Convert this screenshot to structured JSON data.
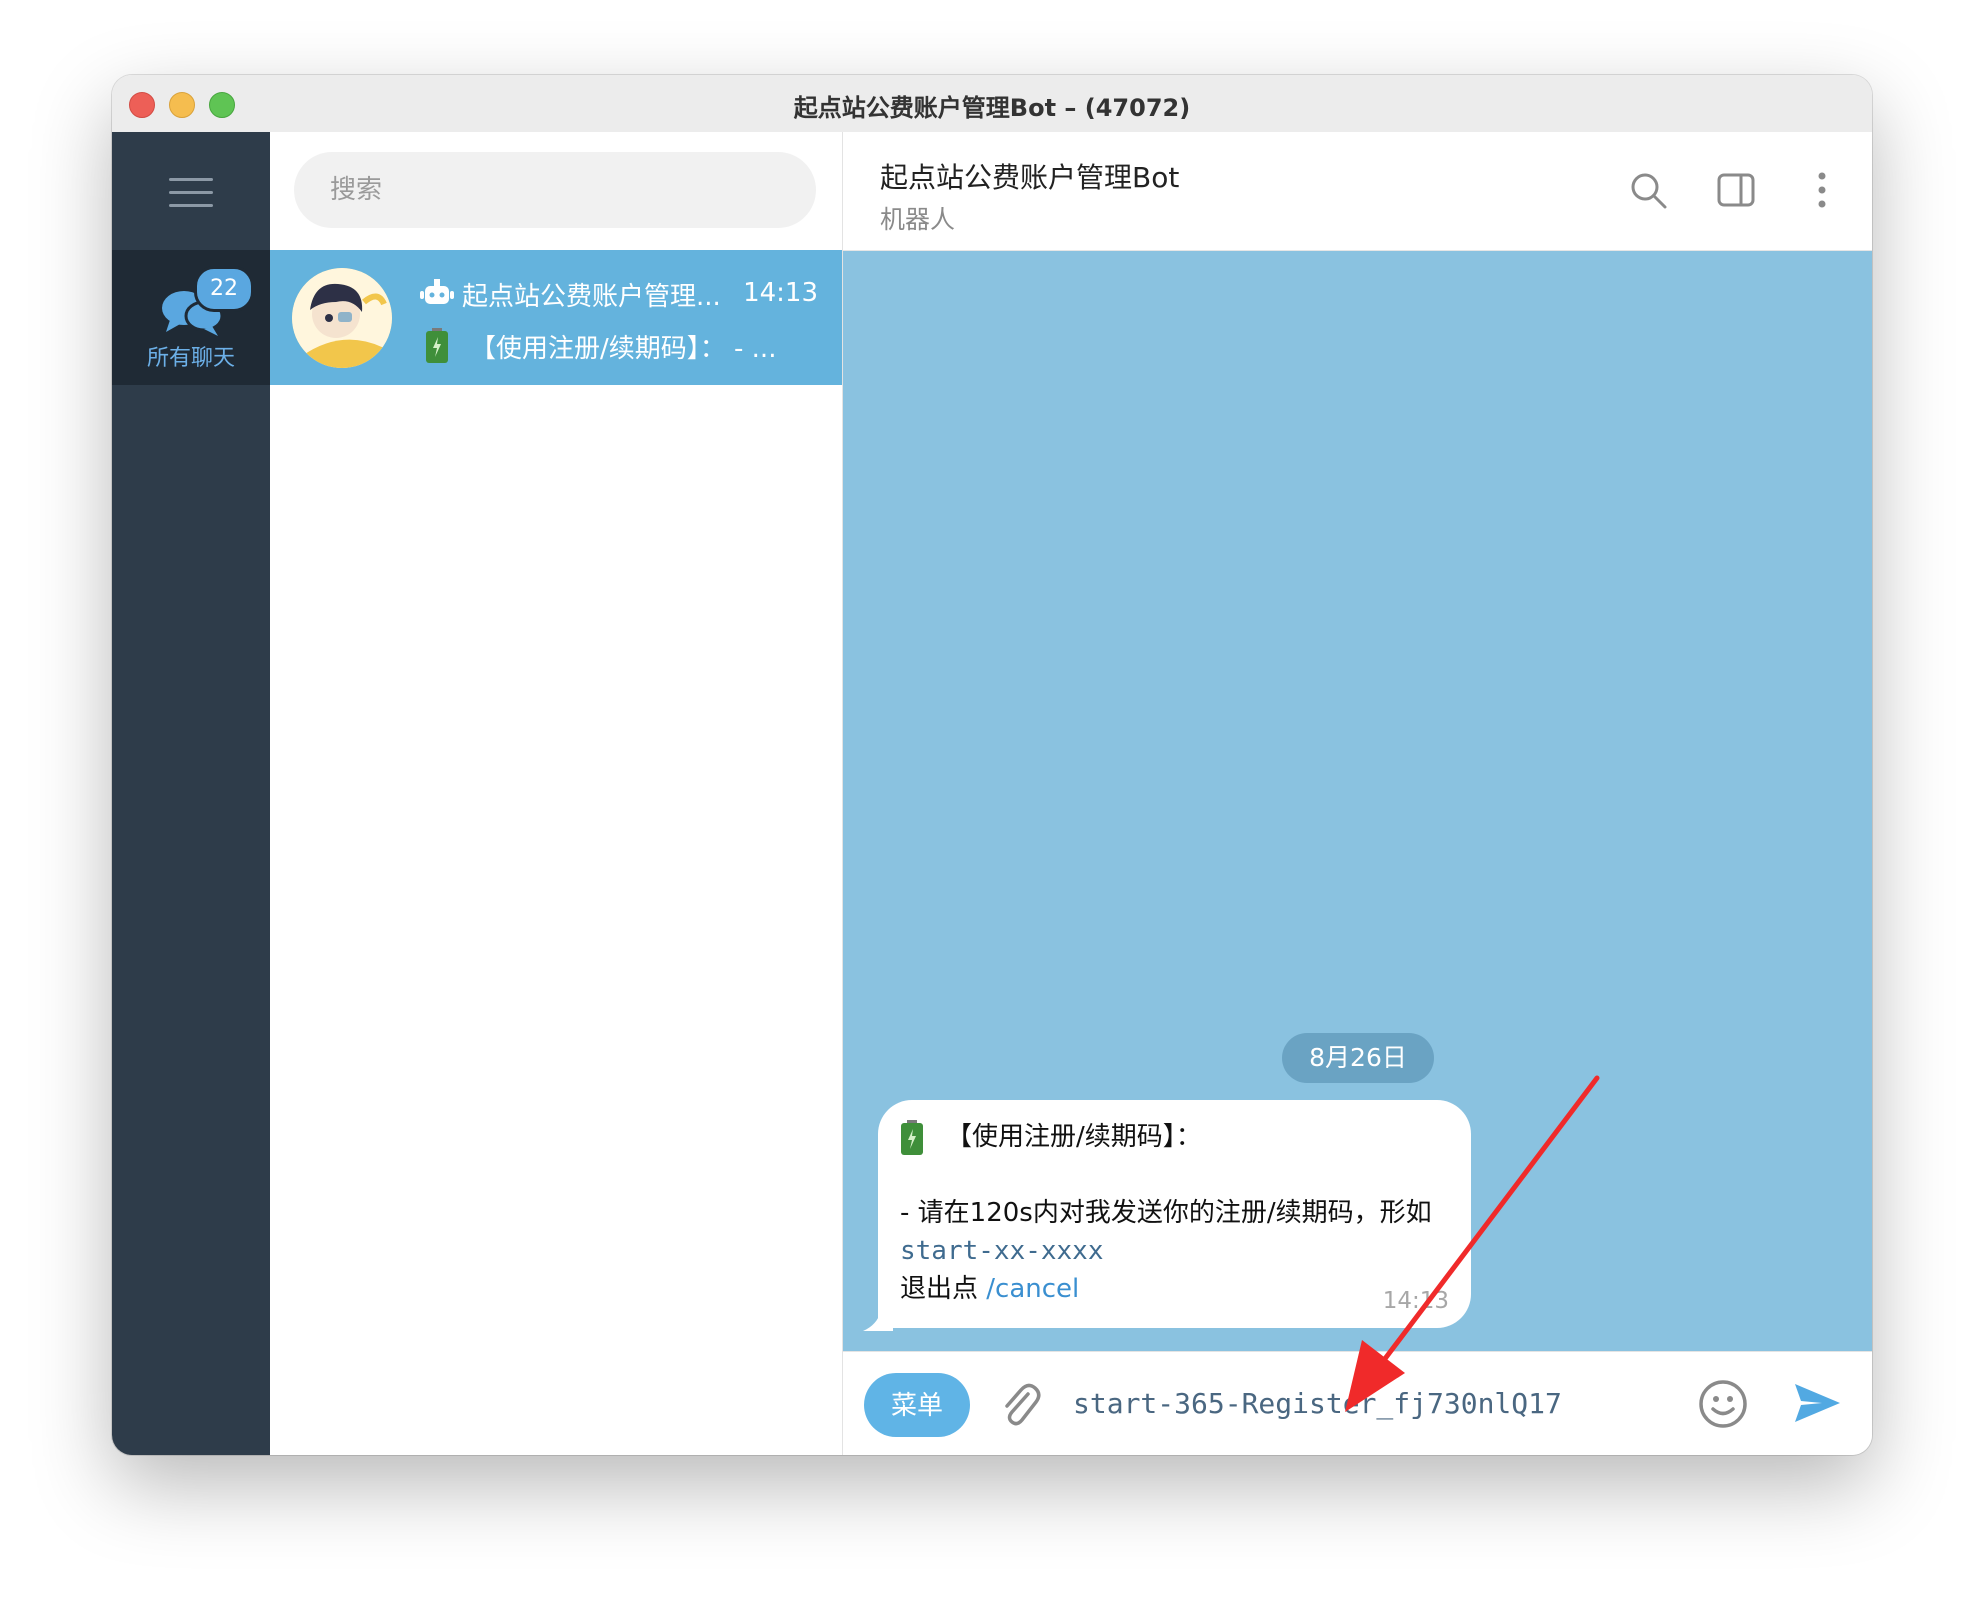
{
  "window": {
    "title": "起点站公费账户管理Bot – (47072)"
  },
  "sidebar": {
    "folder_label": "所有聊天",
    "folder_badge": "22"
  },
  "chatlist": {
    "search_placeholder": "搜索",
    "chats": [
      {
        "name": "起点站公费账户管理...",
        "time": "14:13",
        "preview": "【使用注册/续期码】：  - ..."
      }
    ]
  },
  "header": {
    "name": "起点站公费账户管理Bot",
    "status": "机器人"
  },
  "messages": {
    "date": "8月26日",
    "items": [
      {
        "line1": "【使用注册/续期码】：",
        "line2": "- 请在120s内对我发送你的注册/续期码，形如",
        "code": "start-xx-xxxx",
        "exit_text": "退出点",
        "link": "/cancel",
        "time": "14:13"
      }
    ]
  },
  "composer": {
    "menu_label": "菜单",
    "input_value": "start-365-Register_fj730nlQ17"
  },
  "colors": {
    "accent": "#64b3dd",
    "chat_bg": "#8ac2e0",
    "rail": "#2e3c4a",
    "annotation_arrow": "#f02a2a"
  },
  "icons": [
    "menu-icon",
    "chat-folder-icon",
    "bot-icon",
    "battery-icon",
    "search-icon",
    "side-panel-icon",
    "more-icon",
    "attach-icon",
    "emoji-icon",
    "send-icon"
  ]
}
